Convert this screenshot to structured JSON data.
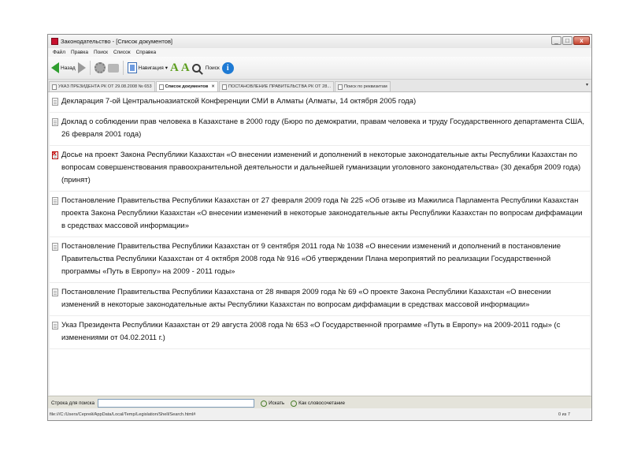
{
  "window": {
    "title": "Законодательство - [Список документов]",
    "controls": {
      "minimize": "_",
      "maximize": "□",
      "close": "x"
    }
  },
  "menu": [
    "Файл",
    "Правка",
    "Поиск",
    "Список",
    "Справка"
  ],
  "toolbar": {
    "back_label": "Назад",
    "navigation_label": "Навигация",
    "search_label": "Поиск",
    "icons": [
      "back-arrow-icon",
      "forward-arrow-icon",
      "settings-icon",
      "print-icon",
      "navigation-icon",
      "font-increase-icon",
      "font-decrease-icon",
      "search-icon",
      "info-icon"
    ],
    "accent": "#2f9e2f"
  },
  "tabs": [
    {
      "label": "УКАЗ ПРЕЗИДЕНТА РК ОТ 29.08.2008 № 653",
      "active": false
    },
    {
      "label": "Список документов",
      "active": true,
      "close": "✕"
    },
    {
      "label": "ПОСТАНОВЛЕНИЕ ПРАВИТЕЛЬСТВА РК ОТ 28...",
      "active": false
    },
    {
      "label": "Поиск по реквизитам",
      "active": false
    }
  ],
  "tab_menu": "▾",
  "documents": [
    {
      "text": "Декларация 7-ой Центральноазиатской Конференции СМИ в Алматы (Алматы, 14 октября 2005 года)",
      "status": "valid"
    },
    {
      "text": "Доклад о соблюдении прав человека в Казахстане в 2000 году (Бюро по демократии, правам человека и труду Государственного департамента США, 26 февраля 2001 года)",
      "status": "valid"
    },
    {
      "text": "Досье на проект Закона Республики Казахстан «О внесении изменений и дополнений в некоторые законодательные акты Республики Казахстан по вопросам совершенствования правоохранительной деятельности и дальнейшей гуманизации уголовного законодательства» (30 декабря 2009 года) (принят)",
      "status": "invalid"
    },
    {
      "text": "Постановление Правительства Республики Казахстан от 27 февраля 2009 года № 225 «Об отзыве из Мажилиса Парламента Республики Казахстан проекта Закона Республики Казахстан «О внесении изменений в некоторые законодательные акты Республики Казахстан по вопросам диффамации в средствах массовой информации»",
      "status": "valid"
    },
    {
      "text": "Постановление Правительства Республики Казахстан от 9 сентября 2011 года № 1038 «О внесении изменений и дополнений в постановление Правительства Республики Казахстан от 4 октября 2008 года № 916 «Об утверждении Плана мероприятий по реализации Государственной программы «Путь в Европу» на 2009 - 2011 годы»",
      "status": "valid"
    },
    {
      "text": "Постановление Правительства Республики Казахстана от 28 января 2009 года № 69 «О проекте Закона Республики Казахстан «О внесении изменений в некоторые законодательные акты Республики Казахстан по вопросам диффамации в средствах массовой информации»",
      "status": "valid"
    },
    {
      "text": "Указ Президента Республики Казахстан от 29 августа 2008 года № 653 «О Государственной программе «Путь в Европу» на 2009-2011 годы» (с изменениями от 04.02.2011 г.)",
      "status": "valid"
    }
  ],
  "searchbar": {
    "label": "Строка для поиска",
    "value": "",
    "find_label": "Искать",
    "phrase_label": "Как словосочетание"
  },
  "status": {
    "path": "file:///C:/Users/Сергей/AppData/Local/Temp/Legislation/Shell/Search.html#",
    "count": "0 из 7"
  }
}
